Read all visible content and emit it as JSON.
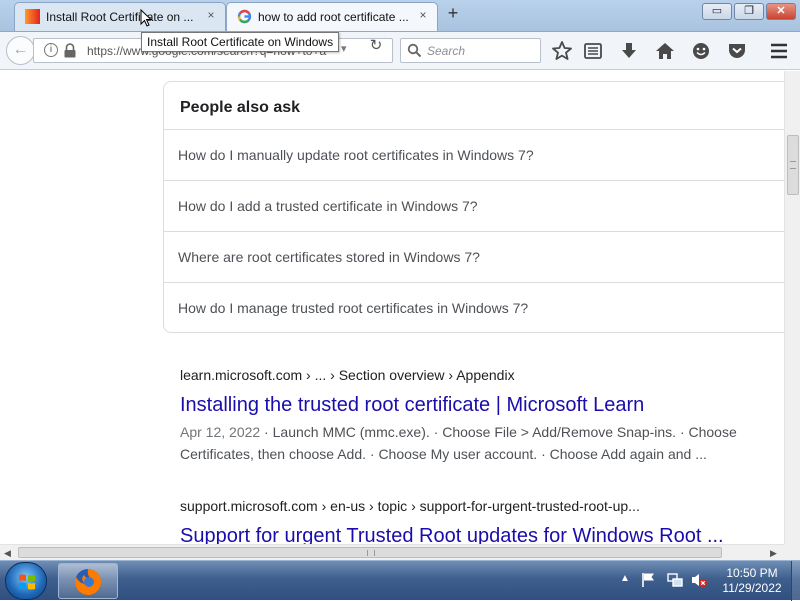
{
  "tabs": [
    {
      "label": "Install Root Certificate on ...",
      "close": "×"
    },
    {
      "label": "how to add root certificate ...",
      "close": "×"
    }
  ],
  "new_tab_label": "+",
  "window_controls": {
    "minimize": "▭",
    "maximize": "❐",
    "close": "✕"
  },
  "nav": {
    "back": "←",
    "info": "i",
    "url": "https://www.google.com/search?q=how+to+a",
    "dropdown": "▾",
    "reload": "↻",
    "search_placeholder": "Search"
  },
  "tooltip": "Install Root Certificate on Windows",
  "paa": {
    "title": "People also ask",
    "questions": [
      "How do I manually update root certificates in Windows 7?",
      "How do I add a trusted certificate in Windows 7?",
      "Where are root certificates stored in Windows 7?",
      "How do I manage trusted root certificates in Windows 7?"
    ]
  },
  "results": [
    {
      "cite": "learn.microsoft.com › ... › Section overview › Appendix",
      "title": "Installing the trusted root certificate | Microsoft Learn",
      "date": "Apr 12, 2022",
      "snippet_line1": "Launch MMC (mmc.exe). · Choose File > Add/Remove Snap-ins. · Choose",
      "snippet_line2": "Certificates, then choose Add. · Choose My user account. · Choose Add again and ..."
    },
    {
      "cite": "support.microsoft.com › en-us › topic › support-for-urgent-trusted-root-up...",
      "title": "Support for urgent Trusted Root updates for Windows Root ..."
    }
  ],
  "scrollbar": {
    "left": "◀",
    "right": "▶"
  },
  "taskbar": {
    "tray_chevron": "▲",
    "time": "10:50 PM",
    "date": "11/29/2022"
  },
  "colors": {
    "link": "#1a0dab",
    "firefox_orange": "#ff7b00",
    "tab_strip": "#b9d1ea"
  }
}
